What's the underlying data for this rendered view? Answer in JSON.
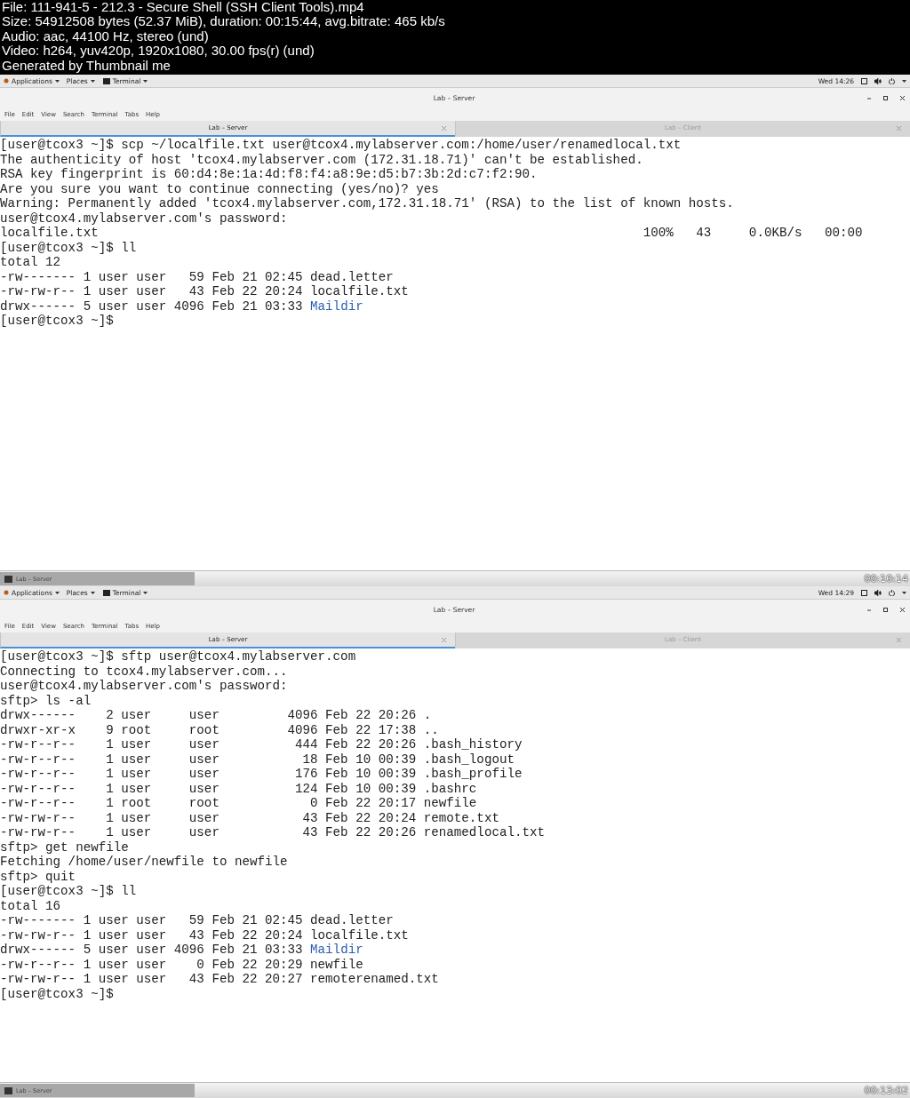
{
  "file_info": [
    "File: 111-941-5 - 212.3 - Secure Shell (SSH Client Tools).mp4",
    "Size: 54912508 bytes (52.37 MiB), duration: 00:15:44, avg.bitrate: 465 kb/s",
    "Audio: aac, 44100 Hz, stereo (und)",
    "Video: h264, yuv420p, 1920x1080, 30.00 fps(r) (und)",
    "Generated by Thumbnail me"
  ],
  "frames": [
    {
      "top_bar": {
        "menus": [
          "Applications",
          "Places",
          "Terminal"
        ],
        "clock": "Wed 14:26"
      },
      "window_title": "Lab – Server",
      "menu": [
        "File",
        "Edit",
        "View",
        "Search",
        "Terminal",
        "Tabs",
        "Help"
      ],
      "tabs": [
        {
          "label": "Lab – Server",
          "selected": true
        },
        {
          "label": "Lab – Client",
          "selected": false
        }
      ],
      "lines": [
        {
          "text": "[user@tcox3 ~]$ scp ~/localfile.txt user@tcox4.mylabserver.com:/home/user/renamedlocal.txt"
        },
        {
          "text": "The authenticity of host 'tcox4.mylabserver.com (172.31.18.71)' can't be established."
        },
        {
          "text": "RSA key fingerprint is 60:d4:8e:1a:4d:f8:f4:a8:9e:d5:b7:3b:2d:c7:f2:90."
        },
        {
          "text": "Are you sure you want to continue connecting (yes/no)? yes"
        },
        {
          "text": "Warning: Permanently added 'tcox4.mylabserver.com,172.31.18.71' (RSA) to the list of known hosts."
        },
        {
          "text": "user@tcox4.mylabserver.com's password:"
        },
        {
          "text": "localfile.txt                                                                        100%   43     0.0KB/s   00:00"
        },
        {
          "text": "[user@tcox3 ~]$ ll"
        },
        {
          "text": "total 12"
        },
        {
          "text": "-rw------- 1 user user   59 Feb 21 02:45 dead.letter"
        },
        {
          "text": "-rw-rw-r-- 1 user user   43 Feb 22 20:24 localfile.txt"
        },
        {
          "text": "drwx------ 5 user user 4096 Feb 21 03:33 ",
          "dir": "Maildir"
        },
        {
          "text": "[user@tcox3 ~]$"
        }
      ],
      "taskbar_item": "Lab – Server",
      "timestamp": "00:10:14"
    },
    {
      "top_bar": {
        "menus": [
          "Applications",
          "Places",
          "Terminal"
        ],
        "clock": "Wed 14:29"
      },
      "window_title": "Lab – Server",
      "menu": [
        "File",
        "Edit",
        "View",
        "Search",
        "Terminal",
        "Tabs",
        "Help"
      ],
      "tabs": [
        {
          "label": "Lab – Server",
          "selected": true
        },
        {
          "label": "Lab – Client",
          "selected": false
        }
      ],
      "lines": [
        {
          "text": "[user@tcox3 ~]$ sftp user@tcox4.mylabserver.com"
        },
        {
          "text": "Connecting to tcox4.mylabserver.com..."
        },
        {
          "text": "user@tcox4.mylabserver.com's password:"
        },
        {
          "text": "sftp> ls -al"
        },
        {
          "text": "drwx------    2 user     user         4096 Feb 22 20:26 ."
        },
        {
          "text": "drwxr-xr-x    9 root     root         4096 Feb 22 17:38 .."
        },
        {
          "text": "-rw-r--r--    1 user     user          444 Feb 22 20:26 .bash_history"
        },
        {
          "text": "-rw-r--r--    1 user     user           18 Feb 10 00:39 .bash_logout"
        },
        {
          "text": "-rw-r--r--    1 user     user          176 Feb 10 00:39 .bash_profile"
        },
        {
          "text": "-rw-r--r--    1 user     user          124 Feb 10 00:39 .bashrc"
        },
        {
          "text": "-rw-r--r--    1 root     root            0 Feb 22 20:17 newfile"
        },
        {
          "text": "-rw-rw-r--    1 user     user           43 Feb 22 20:24 remote.txt"
        },
        {
          "text": "-rw-rw-r--    1 user     user           43 Feb 22 20:26 renamedlocal.txt"
        },
        {
          "text": "sftp> get newfile"
        },
        {
          "text": "Fetching /home/user/newfile to newfile"
        },
        {
          "text": "sftp> quit"
        },
        {
          "text": "[user@tcox3 ~]$ ll"
        },
        {
          "text": "total 16"
        },
        {
          "text": "-rw------- 1 user user   59 Feb 21 02:45 dead.letter"
        },
        {
          "text": "-rw-rw-r-- 1 user user   43 Feb 22 20:24 localfile.txt"
        },
        {
          "text": "drwx------ 5 user user 4096 Feb 21 03:33 ",
          "dir": "Maildir"
        },
        {
          "text": "-rw-r--r-- 1 user user    0 Feb 22 20:29 newfile"
        },
        {
          "text": "-rw-rw-r-- 1 user user   43 Feb 22 20:27 remoterenamed.txt"
        },
        {
          "text": "[user@tcox3 ~]$"
        }
      ],
      "taskbar_item": "Lab – Server",
      "timestamp": "00:13:02"
    }
  ]
}
